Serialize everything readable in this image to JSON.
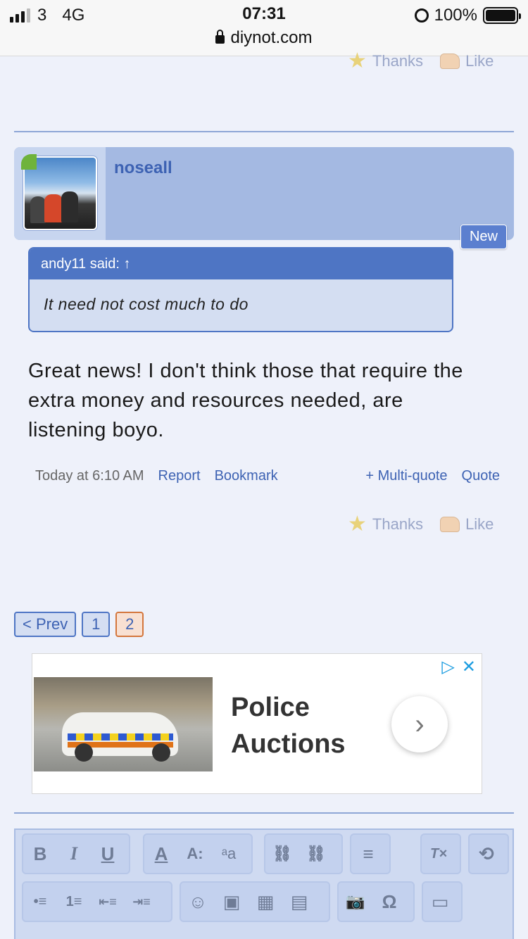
{
  "status_bar": {
    "carrier": "3",
    "network": "4G",
    "time": "07:31",
    "url": "diynot.com",
    "battery": "100%"
  },
  "top_reactions": {
    "thanks": "Thanks",
    "like": "Like"
  },
  "post": {
    "username": "noseall",
    "badge": "New",
    "quote": {
      "header": "andy11 said: ↑",
      "text": "It need not cost much to do"
    },
    "body": "Great news! I don't think those that require the extra money and resources needed, are listening boyo.",
    "meta": {
      "time": "Today at 6:10 AM",
      "report": "Report",
      "bookmark": "Bookmark",
      "multiquote": "+ Multi-quote",
      "quote": "Quote"
    },
    "reactions": {
      "thanks": "Thanks",
      "like": "Like"
    }
  },
  "pagination": {
    "prev": "< Prev",
    "pages": [
      "1",
      "2"
    ],
    "current": "2"
  },
  "ad": {
    "title_line1": "Police",
    "title_line2": "Auctions",
    "arrow": "›",
    "close": "✕",
    "adchoices": "▷"
  },
  "editor": {
    "bold": "B",
    "italic": "I",
    "underline": "U",
    "font_color": "A",
    "font_size": "A:",
    "font_family": "ᵃa",
    "link": "⛓",
    "unlink": "⛓",
    "align": "≡",
    "remove_format": "T×",
    "undo": "⟲",
    "bullets": "•≡",
    "numbers": "1≡",
    "outdent": "⇤≡",
    "indent": "⇥≡",
    "smilie": "☺",
    "image": "▣",
    "media": "▦",
    "quote_block": "▤",
    "camera": "📷",
    "symbol": "Ω",
    "save": "▭"
  }
}
